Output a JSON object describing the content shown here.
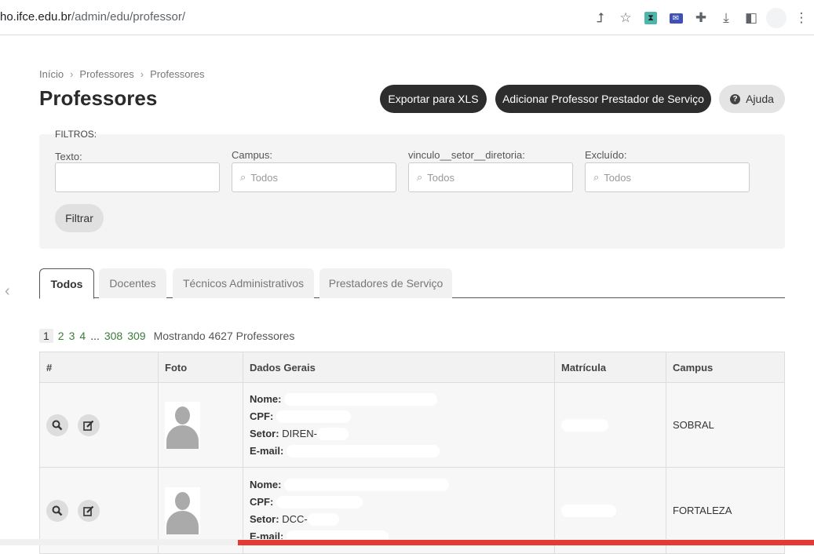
{
  "browser": {
    "url_host": "ho.ifce.edu.br",
    "url_path": "/admin/edu/professor/"
  },
  "breadcrumb": [
    "Início",
    "Professores",
    "Professores"
  ],
  "page_title": "Professores",
  "actions": {
    "export": "Exportar para XLS",
    "add": "Adicionar Professor Prestador de Serviço",
    "help": "Ajuda"
  },
  "filters": {
    "legend": "FILTROS:",
    "texto_label": "Texto:",
    "campus_label": "Campus:",
    "vinculo_label": "vinculo__setor__diretoria:",
    "excluido_label": "Excluído:",
    "placeholder": "Todos",
    "button": "Filtrar"
  },
  "tabs": [
    "Todos",
    "Docentes",
    "Técnicos Administrativos",
    "Prestadores de Serviço"
  ],
  "pagination": {
    "current": "1",
    "pages": [
      "2",
      "3",
      "4"
    ],
    "dots": "...",
    "last": [
      "308",
      "309"
    ],
    "info": "Mostrando 4627 Professores"
  },
  "table": {
    "headers": [
      "#",
      "Foto",
      "Dados Gerais",
      "Matrícula",
      "Campus"
    ],
    "field_labels": {
      "nome": "Nome:",
      "cpf": "CPF:",
      "setor": "Setor:",
      "email": "E-mail:"
    },
    "rows": [
      {
        "setor": "DIREN-",
        "campus": "SOBRAL"
      },
      {
        "setor": "DCC-",
        "campus": "FORTALEZA"
      }
    ]
  }
}
